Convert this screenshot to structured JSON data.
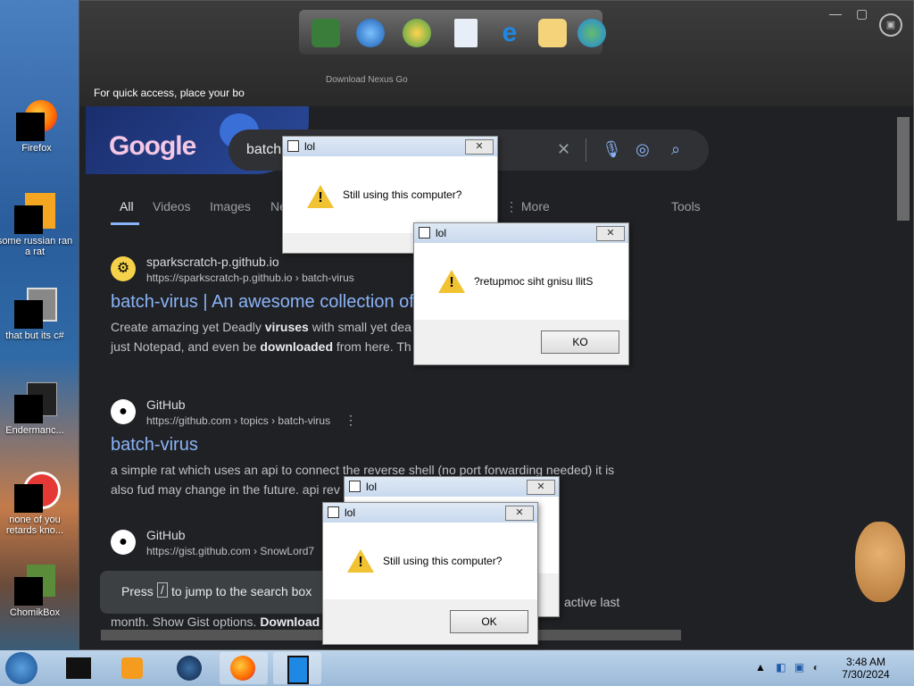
{
  "desktop": {
    "icons": [
      {
        "label": "Firefox"
      },
      {
        "label": "some russian ran a rat"
      },
      {
        "label": "that but its c#"
      },
      {
        "label": "Endermanc..."
      },
      {
        "label": "none of you retards kno..."
      },
      {
        "label": "ChomikBox"
      }
    ]
  },
  "browser": {
    "quick_access": "For quick access, place your bo",
    "dock_label": "Download Nexus Go"
  },
  "google": {
    "logo": "Google",
    "query": "batch",
    "tabs": [
      "All",
      "Videos",
      "Images",
      "Ne",
      "More",
      "Tools"
    ],
    "results": [
      {
        "site": "sparkscratch-p.github.io",
        "url": "https://sparkscratch-p.github.io › batch-virus",
        "title": "batch-virus | An awesome collection of",
        "snippet_1a": "Create amazing yet Deadly ",
        "snippet_1b": "viruses",
        "snippet_1c": " with small yet dea",
        "snippet_2a": "just Notepad, and even be ",
        "snippet_2b": "downloaded",
        "snippet_2c": " from here. Th"
      },
      {
        "site": "GitHub",
        "url": "https://github.com › topics › batch-virus",
        "title": "batch-virus",
        "snippet_1": "a simple rat which uses an api to connect the reverse shell (no port forwarding needed) it is",
        "snippet_2": "also fud may change in the future. api rev"
      },
      {
        "site": "GitHub",
        "url": "https://gist.github.com › SnowLord7",
        "snippet_1_tail": "active last",
        "snippet_2a": "month. Show Gist options. ",
        "snippet_2b": "Download"
      }
    ],
    "toast_pre": "Press",
    "toast_key": "/",
    "toast_post": "to jump to the search box"
  },
  "dialogs": [
    {
      "title": "lol",
      "message": "Still using this computer?"
    },
    {
      "title": "lol",
      "message": "?retupmoc siht gnisu llitS",
      "button": "KO"
    },
    {
      "title": "lol"
    },
    {
      "title": "lol",
      "message": "Still using this computer?",
      "button": "OK"
    }
  ],
  "taskbar": {
    "time": "3:48 AM",
    "date": "7/30/2024"
  }
}
